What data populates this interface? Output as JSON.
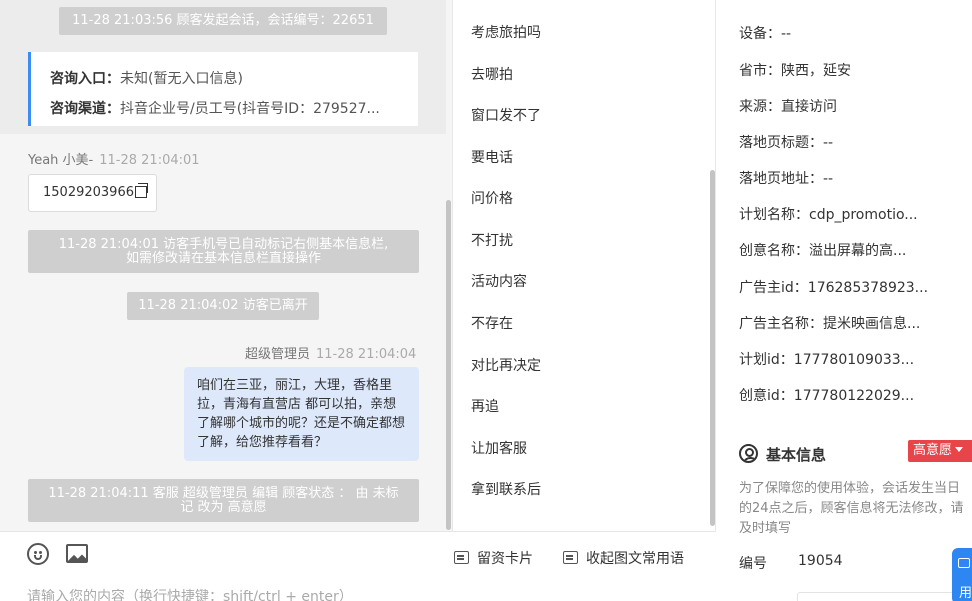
{
  "chat": {
    "system_session": "11-28 21:03:56 顾客发起会话，会话编号：22651",
    "source_card": {
      "entry_label": "咨询入口：",
      "entry_value": "未知(暂无入口信息)",
      "channel_label": "咨询渠道：",
      "channel_value": "抖音企业号/员工号(抖音号ID：279527..."
    },
    "visitor_name": "Yeah 小美-",
    "visitor_time": "11-28 21:04:01",
    "visitor_phone": "15029203966",
    "system_phone_line1": "11-28 21:04:01 访客手机号已自动标记右侧基本信息栏,",
    "system_phone_line2": "如需修改请在基本信息栏直接操作",
    "system_left": "11-28 21:04:02 访客已离开",
    "agent_name": "超级管理员",
    "agent_time": "11-28 21:04:04",
    "agent_message": "咱们在三亚，丽江，大理，香格里拉，青海有直营店 都可以拍，亲想了解哪个城市的呢？还是不确定都想了解，给您推荐看看？",
    "system_edit_line1": "11-28 21:04:11 客服 超级管理员 编辑 顾客状态 ： 由 未标",
    "system_edit_line2": "记 改为 高意愿"
  },
  "input": {
    "placeholder": "请输入您的内容（换行快捷键：shift/ctrl + enter）",
    "lead_card_label": "留资卡片",
    "collapse_label": "收起图文常用语"
  },
  "phrases": [
    "考虑旅拍吗",
    "去哪拍",
    "窗口发不了",
    "要电话",
    "问价格",
    "不打扰",
    "活动内容",
    "不存在",
    "对比再决定",
    "再追",
    "让加客服",
    "拿到联系后"
  ],
  "info": {
    "fields": [
      {
        "label": "设备：",
        "value": "--"
      },
      {
        "label": "省市：",
        "value": "陕西，延安"
      },
      {
        "label": "来源：",
        "value": "直接访问"
      },
      {
        "label": "落地页标题：",
        "value": "--"
      },
      {
        "label": "落地页地址：",
        "value": "--"
      },
      {
        "label": "计划名称：",
        "value": "cdp_promotio..."
      },
      {
        "label": "创意名称：",
        "value": "溢出屏幕的高..."
      },
      {
        "label": "广告主id：",
        "value": "176285378923..."
      },
      {
        "label": "广告主名称：",
        "value": "提米映画信息..."
      },
      {
        "label": "计划id：",
        "value": "177780109033..."
      },
      {
        "label": "创意id：",
        "value": "177780122029..."
      }
    ],
    "basic_title": "基本信息",
    "intent_badge": "高意愿",
    "notice": "为了保障您的使用体验，会话发生当日的24点之后，顾客信息将无法修改，请及时填写",
    "id_label": "编号",
    "id_value": "19054",
    "float_label": "用"
  },
  "colors": {
    "accent": "#3b8cf3",
    "badge": "#e8454b",
    "agent_bubble": "#dde9fb",
    "system_pill": "#cfcfcf"
  }
}
